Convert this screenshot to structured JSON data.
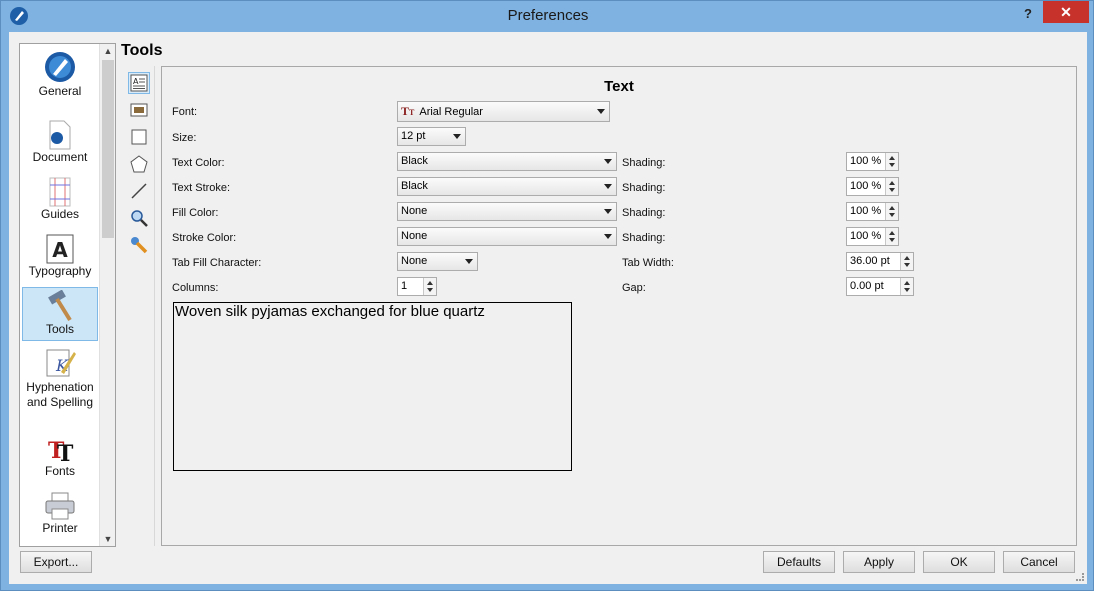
{
  "window": {
    "title": "Preferences",
    "help": "?",
    "close": "✕"
  },
  "sidebar": {
    "items": [
      {
        "label": "General",
        "icon": "pen-nib-icon"
      },
      {
        "label": "Document",
        "icon": "document-icon"
      },
      {
        "label": "Guides",
        "icon": "guides-icon"
      },
      {
        "label": "Typography",
        "icon": "typography-icon"
      },
      {
        "label": "Tools",
        "icon": "hammer-icon"
      },
      {
        "label": "Hyphenation and Spelling",
        "icon": "quill-icon"
      },
      {
        "label": "Fonts",
        "icon": "fonts-icon"
      },
      {
        "label": "Printer",
        "icon": "printer-icon"
      }
    ],
    "selected": "Tools"
  },
  "section_title": "Tools",
  "tools": [
    "text-frame-tool-icon",
    "image-frame-tool-icon",
    "shape-tool-icon",
    "polygon-tool-icon",
    "line-tool-icon",
    "zoom-tool-icon",
    "miscellaneous-tool-icon"
  ],
  "panel": {
    "title": "Text",
    "font": {
      "label": "Font:",
      "value": "Arial Regular"
    },
    "size": {
      "label": "Size:",
      "value": "12 pt"
    },
    "text_color": {
      "label": "Text Color:",
      "value": "Black",
      "shading_label": "Shading:",
      "shading": "100 %"
    },
    "text_stroke": {
      "label": "Text Stroke:",
      "value": "Black",
      "shading_label": "Shading:",
      "shading": "100 %"
    },
    "fill_color": {
      "label": "Fill Color:",
      "value": "None",
      "shading_label": "Shading:",
      "shading": "100 %"
    },
    "stroke_color": {
      "label": "Stroke Color:",
      "value": "None",
      "shading_label": "Shading:",
      "shading": "100 %"
    },
    "tab_fill": {
      "label": "Tab Fill Character:",
      "value": "None"
    },
    "tab_width": {
      "label": "Tab Width:",
      "value": "36.00 pt"
    },
    "columns": {
      "label": "Columns:",
      "value": "1"
    },
    "gap": {
      "label": "Gap:",
      "value": "0.00 pt"
    },
    "preview_text": "Woven silk pyjamas exchanged for blue quartz"
  },
  "buttons": {
    "export": "Export...",
    "defaults": "Defaults",
    "apply": "Apply",
    "ok": "OK",
    "cancel": "Cancel"
  }
}
